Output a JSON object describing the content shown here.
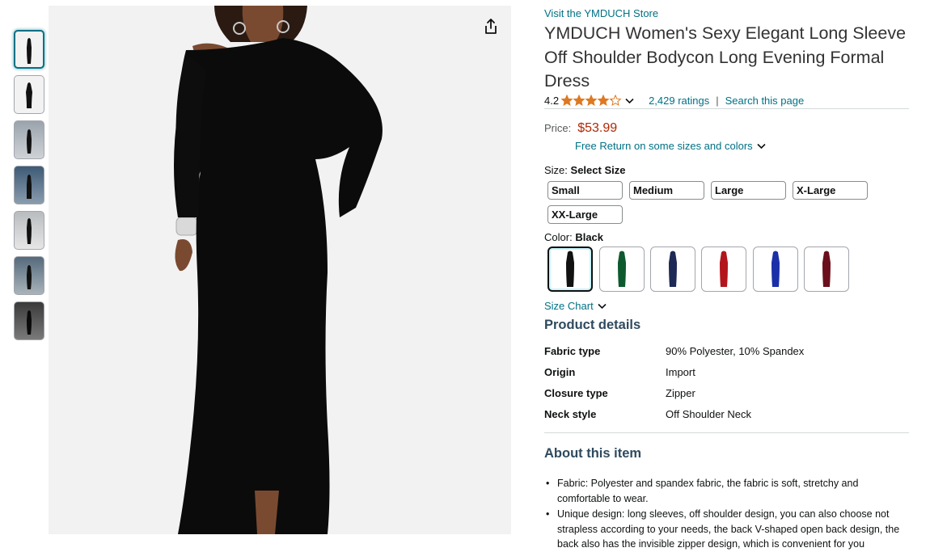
{
  "store": {
    "link_text": "Visit the YMDUCH Store"
  },
  "product": {
    "title": "YMDUCH Women's Sexy Elegant Long Sleeve Off Shoulder Bodycon Long Evening Formal Dress",
    "rating_value": "4.2",
    "ratings_count": "2,429 ratings",
    "search_page": "Search this page",
    "separator": "|"
  },
  "price": {
    "label": "Price:",
    "amount": "$53.99",
    "free_return": "Free Return on some sizes and colors"
  },
  "size": {
    "label": "Size:",
    "selected_label": "Select Size",
    "options": [
      "Small",
      "Medium",
      "Large",
      "X-Large",
      "XX-Large"
    ]
  },
  "color": {
    "label": "Color:",
    "selected": "Black",
    "swatches": [
      {
        "name": "Black",
        "hex": "#111111"
      },
      {
        "name": "Green",
        "hex": "#0d5a2e"
      },
      {
        "name": "Navy",
        "hex": "#1c2a55"
      },
      {
        "name": "Red",
        "hex": "#b3151c"
      },
      {
        "name": "Royal Blue",
        "hex": "#1b2fa8"
      },
      {
        "name": "Wine",
        "hex": "#6b0f1c"
      }
    ]
  },
  "size_chart": "Size Chart",
  "product_details": {
    "title": "Product details",
    "rows": [
      {
        "key": "Fabric type",
        "value": "90% Polyester, 10% Spandex"
      },
      {
        "key": "Origin",
        "value": "Import"
      },
      {
        "key": "Closure type",
        "value": "Zipper"
      },
      {
        "key": "Neck style",
        "value": "Off Shoulder Neck"
      }
    ]
  },
  "about": {
    "title": "About this item",
    "bullets": [
      "Fabric: Polyester and spandex fabric, the fabric is soft, stretchy and comfortable to wear.",
      "Unique design: long sleeves, off shoulder design, you can also choose not strapless according to your needs, the back V-shaped open back design, the back also has the invisible zipper design, which is convenient for you"
    ]
  },
  "colors": {
    "link": "#007185",
    "price": "#b12704",
    "star": "#de7921",
    "heading": "#2f4a5e"
  },
  "icons": {
    "share": "share-icon",
    "chevron": "chevron-down-icon",
    "star": "star-icon"
  }
}
